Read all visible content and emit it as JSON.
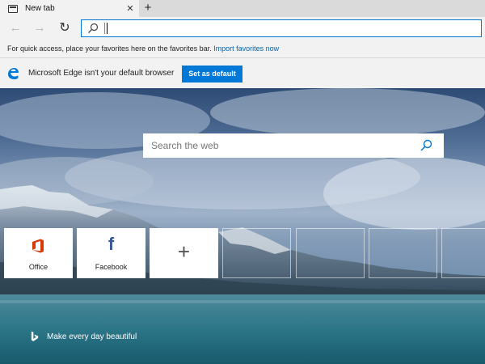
{
  "tab": {
    "title": "New tab",
    "close_glyph": "✕"
  },
  "tabstrip": {
    "new_tab_glyph": "+"
  },
  "nav": {
    "back_glyph": "←",
    "forward_glyph": "→",
    "refresh_glyph": "↻"
  },
  "address": {
    "value": "",
    "icon": "search-icon"
  },
  "favorites_bar": {
    "message": "For quick access, place your favorites here on the favorites bar.",
    "link": "Import favorites now"
  },
  "default_banner": {
    "message": "Microsoft Edge isn't your default browser",
    "button": "Set as default",
    "button_color": "#0078d7"
  },
  "search": {
    "placeholder": "Search the web"
  },
  "tiles": [
    {
      "label": "Office",
      "icon": "office-icon",
      "icon_color": "#d83b01"
    },
    {
      "label": "Facebook",
      "icon": "facebook-icon",
      "glyph": "f",
      "icon_color": "#3b5998"
    },
    {
      "label": "",
      "icon": "plus-icon",
      "glyph": "+"
    }
  ],
  "empty_tiles": 4,
  "footer": {
    "text": "Make every day beautiful",
    "icon": "bing-icon"
  }
}
